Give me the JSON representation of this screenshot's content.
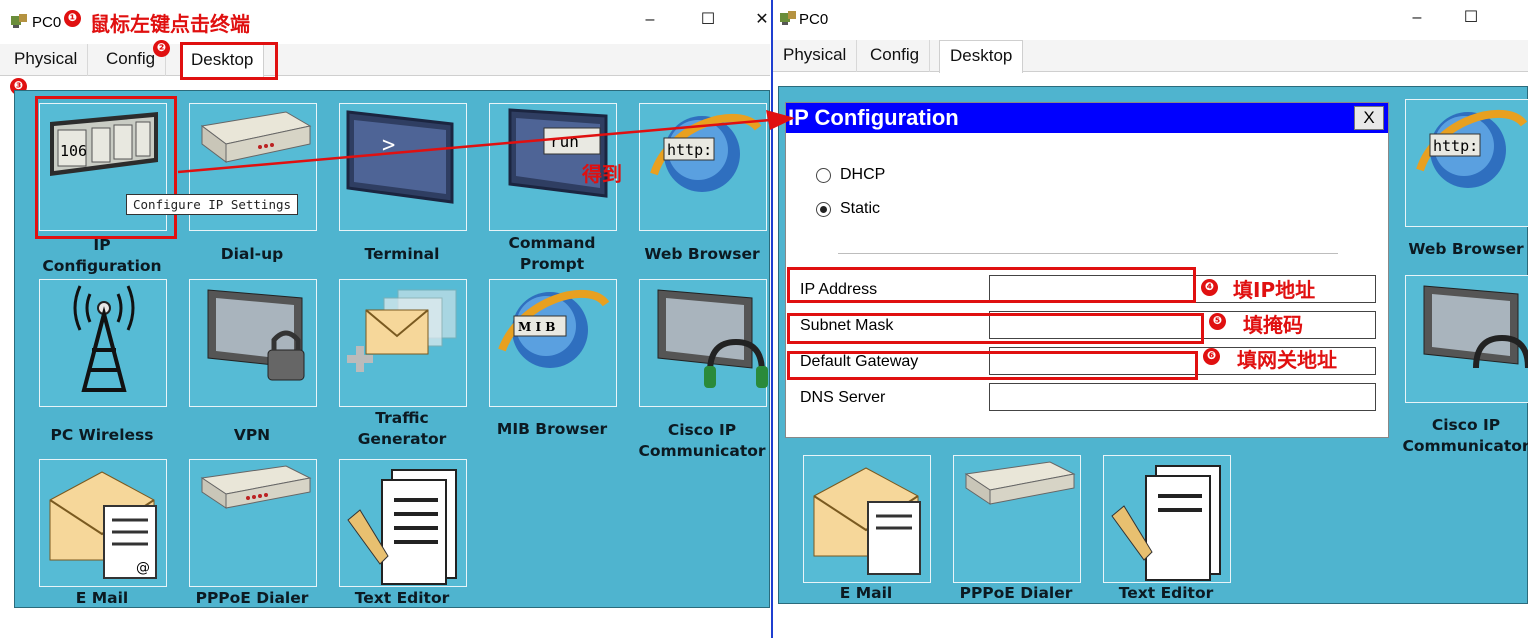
{
  "left": {
    "title": "PC0",
    "tabs": [
      "Physical",
      "Config",
      "Desktop"
    ],
    "active_tab": "Desktop",
    "tooltip": "Configure IP Settings",
    "apps": [
      {
        "label": "IP\nConfiguration",
        "icon": "ip-configuration-icon"
      },
      {
        "label": "Dial-up",
        "icon": "dialup-modem-icon"
      },
      {
        "label": "Terminal",
        "icon": "terminal-icon"
      },
      {
        "label": "Command\nPrompt",
        "icon": "command-prompt-icon"
      },
      {
        "label": "Web Browser",
        "icon": "web-browser-icon"
      },
      {
        "label": "PC Wireless",
        "icon": "wireless-tower-icon"
      },
      {
        "label": "VPN",
        "icon": "vpn-lock-icon"
      },
      {
        "label": "Traffic\nGenerator",
        "icon": "traffic-generator-icon"
      },
      {
        "label": "MIB Browser",
        "icon": "mib-browser-icon"
      },
      {
        "label": "Cisco IP\nCommunicator",
        "icon": "cisco-ip-communicator-icon"
      },
      {
        "label": "E Mail",
        "icon": "email-icon"
      },
      {
        "label": "PPPoE Dialer",
        "icon": "pppoe-dialer-icon"
      },
      {
        "label": "Text Editor",
        "icon": "text-editor-icon"
      }
    ],
    "icon_texts": {
      "ip": "106",
      "terminal": ">",
      "command": "run",
      "browser": "http:",
      "mib": "M I B"
    }
  },
  "right": {
    "title": "PC0",
    "tabs": [
      "Physical",
      "Config",
      "Desktop"
    ],
    "active_tab": "Desktop",
    "apps_visible": [
      {
        "label": "Web Browser"
      },
      {
        "label": "Cisco IP\nCommunicator"
      },
      {
        "label": "E Mail"
      },
      {
        "label": "PPPoE Dialer"
      },
      {
        "label": "Text Editor"
      }
    ],
    "dialog": {
      "title": "IP Configuration",
      "close": "X",
      "modes": [
        {
          "label": "DHCP",
          "selected": false
        },
        {
          "label": "Static",
          "selected": true
        }
      ],
      "fields": [
        {
          "label": "IP Address",
          "value": ""
        },
        {
          "label": "Subnet Mask",
          "value": ""
        },
        {
          "label": "Default Gateway",
          "value": ""
        },
        {
          "label": "DNS Server",
          "value": ""
        }
      ]
    }
  },
  "annotations": {
    "step1": "鼠标左键点击终端",
    "step4": "填IP地址",
    "step5": "填掩码",
    "step6": "填网关地址",
    "arrow_label": "得到",
    "badges": [
      "❶",
      "❷",
      "❸",
      "❹",
      "❺",
      "❻"
    ],
    "accent_color": "#e01010"
  },
  "colors": {
    "desktop": "#4fb4cf",
    "dialog_title": "#0000ff"
  }
}
